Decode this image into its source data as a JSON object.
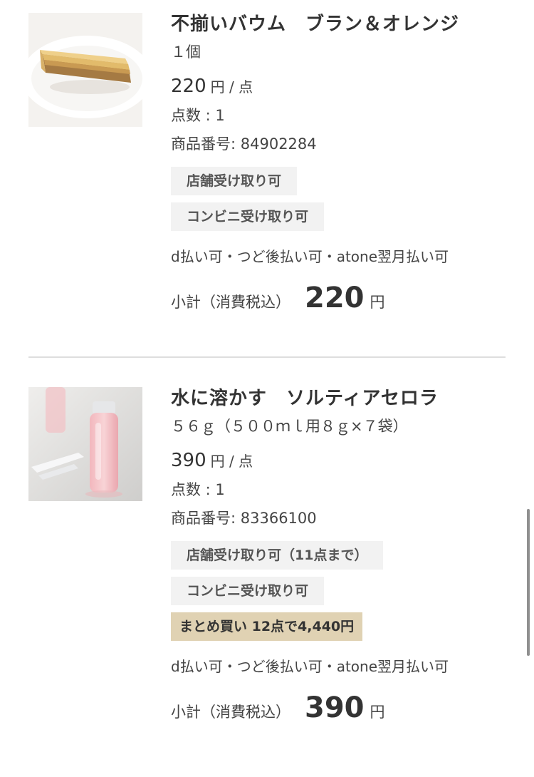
{
  "items": [
    {
      "title": "不揃いバウム　ブラン＆オレンジ",
      "subtitle": "１個",
      "price": "220",
      "price_unit": "円 / 点",
      "quantity": "点数 : 1",
      "product_no": "商品番号: 84902284",
      "tags": [
        "店舗受け取り可",
        "コンビニ受け取り可"
      ],
      "payment": "d払い可・つど後払い可・atone翌月払い可",
      "subtotal_label": "小計（消費税込）",
      "subtotal_value": "220",
      "subtotal_unit": "円",
      "image": "baumkuchen-on-plate"
    },
    {
      "title": "水に溶かす　ソルティアセロラ",
      "subtitle": "５６ｇ（５００ｍｌ用８ｇ×７袋）",
      "price": "390",
      "price_unit": "円 / 点",
      "quantity": "点数 : 1",
      "product_no": "商品番号: 83366100",
      "tags": [
        "店舗受け取り可（11点まで）",
        "コンビニ受け取り可"
      ],
      "bulk_tag": "まとめ買い 12点で4,440円",
      "payment": "d払い可・つど後払い可・atone翌月払い可",
      "subtotal_label": "小計（消費税込）",
      "subtotal_value": "390",
      "subtotal_unit": "円",
      "image": "pink-drink-bottle"
    }
  ],
  "colors": {
    "tag_bg": "#f2f2f2",
    "bulk_tag_bg": "#e0d2b3",
    "divider": "#dedede"
  }
}
